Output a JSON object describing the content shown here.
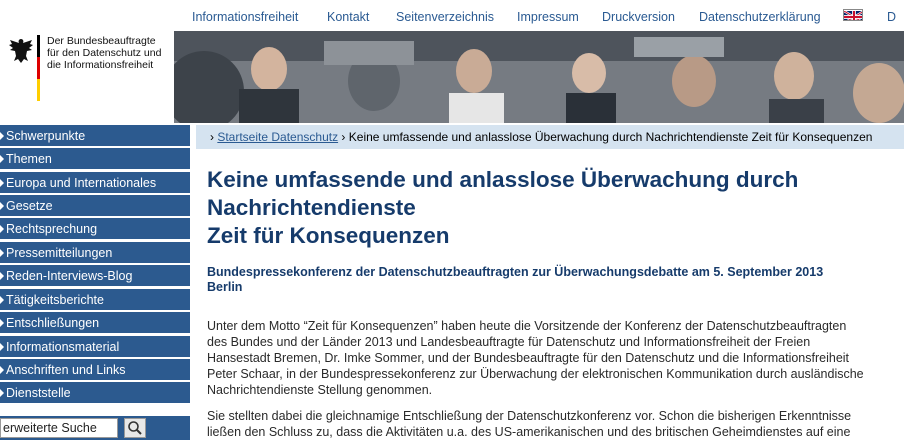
{
  "topnav": {
    "links": [
      "Informationsfreiheit",
      "Kontakt",
      "Seitenverzeichnis",
      "Impressum",
      "Druckversion",
      "Datenschutzerklärung"
    ],
    "language_icon": "uk-flag-icon",
    "language_partial": "D"
  },
  "logo": {
    "line1": "Der Bundesbeauftragte",
    "line2": "für den Datenschutz und",
    "line3": "die Informationsfreiheit",
    "flag_colors": [
      "#000000",
      "#dd0000",
      "#ffce00"
    ]
  },
  "sidebar": {
    "items": [
      "Schwerpunkte",
      "Themen",
      "Europa und Internationales",
      "Gesetze",
      "Rechtsprechung",
      "Pressemitteilungen",
      "Reden-Interviews-Blog",
      "Tätigkeitsberichte",
      "Entschließungen",
      "Informationsmaterial",
      "Anschriften und Links",
      "Dienststelle"
    ],
    "search_value": "erweiterte Suche",
    "search_icon": "magnifier-icon"
  },
  "breadcrumb": {
    "home": "Startseite Datenschutz",
    "current": "Keine umfassende und anlasslose Überwachung durch Nachrichtendienste Zeit für Konsequenzen"
  },
  "article": {
    "headline_lines": [
      "Keine umfassende und anlasslose Überwachung durch",
      "Nachrichtendienste",
      "Zeit für Konsequenzen"
    ],
    "subtitle_lines": [
      "Bundespressekonferenz der Datenschutzbeauftragten zur Überwachungsdebatte am 5. September 2013",
      "Berlin"
    ],
    "para1_lines": [
      "Unter dem Motto “Zeit für Konsequenzen” haben heute die Vorsitzende der Konferenz der Datenschutzbeauftragten",
      "des Bundes und der Länder 2013 und Landesbeauftragte für Datenschutz und Informationsfreiheit der Freien",
      "Hansestadt Bremen, Dr. Imke Sommer, und der Bundesbeauftragte für den Datenschutz und die Informationsfreiheit",
      "Peter Schaar, in der Bundespressekonferenz zur Überwachung der elektronischen Kommunikation durch ausländische",
      "Nachrichtendienste Stellung genommen."
    ],
    "para2_lines": [
      "Sie stellten dabei die gleichnamige Entschließung der Datenschutzkonferenz vor. Schon die bisherigen Erkenntnisse",
      "ließen den Schluss zu, dass die Aktivitäten u.a. des US-amerikanischen und des britischen Geheimdienstes auf eine"
    ]
  },
  "colors": {
    "nav_blue": "#2c5a8f",
    "link_blue": "#2a5a92",
    "headline_blue": "#163b6b",
    "breadcrumb_bg": "#d5e3f0"
  }
}
